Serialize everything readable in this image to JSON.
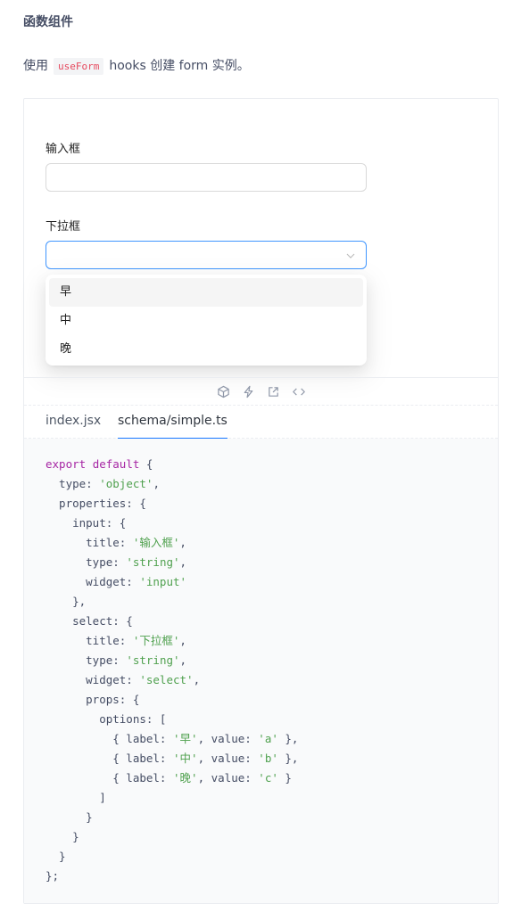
{
  "section": {
    "title": "函数组件"
  },
  "description": {
    "before": "使用",
    "code": "useForm",
    "after": "hooks 创建 form 实例。"
  },
  "form": {
    "input_label": "输入框",
    "input_value": "",
    "select_label": "下拉框",
    "select_value": "",
    "options": [
      "早",
      "中",
      "晚"
    ]
  },
  "actions": {
    "icons": [
      "codesandbox-icon",
      "stackblitz-icon",
      "open-external-icon",
      "code-icon"
    ]
  },
  "tabs": [
    {
      "label": "index.jsx",
      "active": false
    },
    {
      "label": "schema/simple.ts",
      "active": true
    }
  ],
  "code": {
    "lines": [
      [
        [
          "kw",
          "export"
        ],
        [
          "p",
          " "
        ],
        [
          "kw",
          "default"
        ],
        [
          "p",
          " {"
        ]
      ],
      [
        [
          "p",
          "  type: "
        ],
        [
          "s",
          "'object'"
        ],
        [
          "p",
          ","
        ]
      ],
      [
        [
          "p",
          "  properties: {"
        ]
      ],
      [
        [
          "p",
          "    input: {"
        ]
      ],
      [
        [
          "p",
          "      title: "
        ],
        [
          "s",
          "'输入框'"
        ],
        [
          "p",
          ","
        ]
      ],
      [
        [
          "p",
          "      type: "
        ],
        [
          "s",
          "'string'"
        ],
        [
          "p",
          ","
        ]
      ],
      [
        [
          "p",
          "      widget: "
        ],
        [
          "s",
          "'input'"
        ]
      ],
      [
        [
          "p",
          "    },"
        ]
      ],
      [
        [
          "p",
          "    select: {"
        ]
      ],
      [
        [
          "p",
          "      title: "
        ],
        [
          "s",
          "'下拉框'"
        ],
        [
          "p",
          ","
        ]
      ],
      [
        [
          "p",
          "      type: "
        ],
        [
          "s",
          "'string'"
        ],
        [
          "p",
          ","
        ]
      ],
      [
        [
          "p",
          "      widget: "
        ],
        [
          "s",
          "'select'"
        ],
        [
          "p",
          ","
        ]
      ],
      [
        [
          "p",
          "      props: {"
        ]
      ],
      [
        [
          "p",
          "        options: ["
        ]
      ],
      [
        [
          "p",
          "          { label: "
        ],
        [
          "s",
          "'早'"
        ],
        [
          "p",
          ", value: "
        ],
        [
          "s",
          "'a'"
        ],
        [
          "p",
          " },"
        ]
      ],
      [
        [
          "p",
          "          { label: "
        ],
        [
          "s",
          "'中'"
        ],
        [
          "p",
          ", value: "
        ],
        [
          "s",
          "'b'"
        ],
        [
          "p",
          " },"
        ]
      ],
      [
        [
          "p",
          "          { label: "
        ],
        [
          "s",
          "'晚'"
        ],
        [
          "p",
          ", value: "
        ],
        [
          "s",
          "'c'"
        ],
        [
          "p",
          " }"
        ]
      ],
      [
        [
          "p",
          "        ]"
        ]
      ],
      [
        [
          "p",
          "      }"
        ]
      ],
      [
        [
          "p",
          "    }"
        ]
      ],
      [
        [
          "p",
          "  }"
        ]
      ],
      [
        [
          "p",
          "};"
        ]
      ]
    ]
  },
  "colors": {
    "accent": "#4096ff",
    "tab_underline": "#1677ff",
    "code_keyword": "#a626a4",
    "code_string": "#50a14f",
    "inline_code": "#e6495e"
  }
}
